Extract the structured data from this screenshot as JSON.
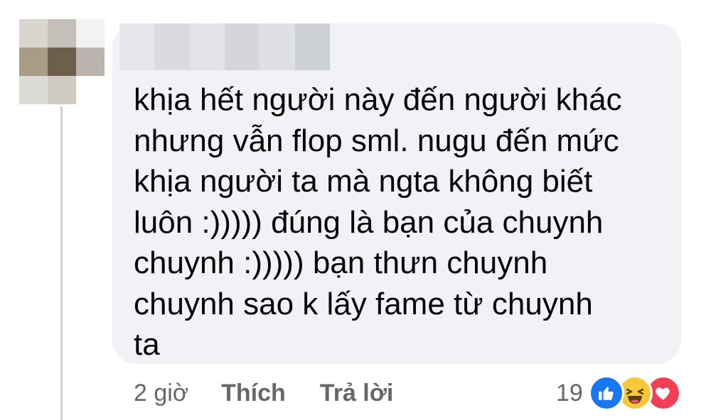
{
  "comment": {
    "author_name": "",
    "text_lines": [
      "khịa hết người này đến người khác",
      "nhưng vẫn flop sml. nugu đến mức",
      "khịa người ta mà ngta không biết",
      "luôn :))))) đúng là bạn của chuynh",
      "chuynh :))))) bạn thưn chuynh",
      "chuynh sao k lấy fame từ chuynh",
      "ta"
    ]
  },
  "actions": {
    "timestamp": "2 giờ",
    "like_label": "Thích",
    "reply_label": "Trả lời"
  },
  "reactions": {
    "count": "19",
    "icons": [
      "like-icon",
      "haha-icon",
      "love-icon"
    ]
  },
  "colors": {
    "bubble_background": "#f0f2f5",
    "text": "#050505",
    "secondary_text": "#65676b",
    "like_blue": "#1877f2",
    "haha_yellow": "#f7c93a",
    "love_red": "#f33e58"
  }
}
